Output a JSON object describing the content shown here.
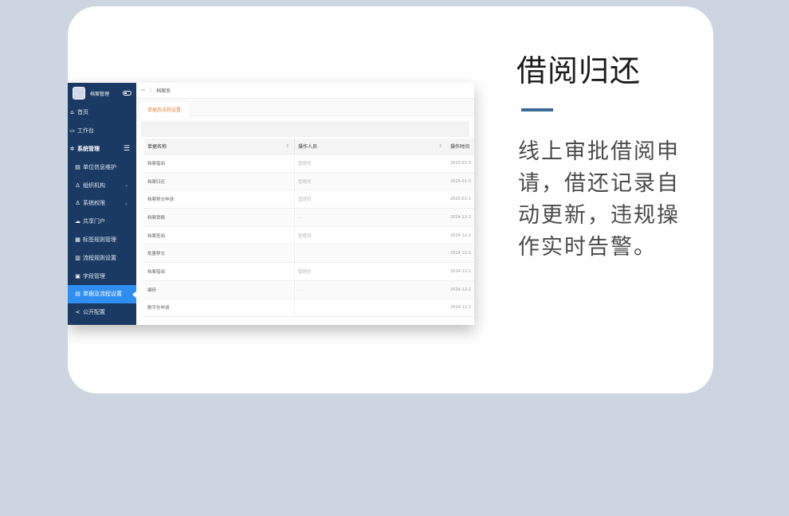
{
  "feature": {
    "title": "借阅归还",
    "description": "线上审批借阅申请，借还记录自动更新，违规操作实时告警。"
  },
  "colors": {
    "page_bg": "#ccd5e0",
    "sidebar_bg": "#1a3a63",
    "active_bg": "#2f8ef0",
    "accent": "#3d6a97"
  },
  "app": {
    "brand": "档案管理",
    "sidebar": {
      "items": [
        {
          "label": "首页",
          "icon": "home-icon"
        },
        {
          "label": "工作台",
          "icon": "desktop-icon"
        },
        {
          "label": "系统管理",
          "icon": "gear-icon"
        },
        {
          "label": "单位信息维护",
          "icon": "doc-icon"
        },
        {
          "label": "组织机构",
          "icon": "user-icon"
        },
        {
          "label": "系统权限",
          "icon": "users-icon"
        },
        {
          "label": "共享门户",
          "icon": "cloud-icon"
        },
        {
          "label": "标签规则管理",
          "icon": "grid-icon"
        },
        {
          "label": "流程规则设置",
          "icon": "table-icon"
        },
        {
          "label": "字段管理",
          "icon": "file-icon"
        },
        {
          "label": "单据及流程设置",
          "icon": "list-icon"
        },
        {
          "label": "公开配置",
          "icon": "share-icon"
        }
      ]
    },
    "topbar": {
      "back": "⇦",
      "breadcrumb": "档案系"
    },
    "tab": "单据及流程设置",
    "table": {
      "headers": [
        "单据名称",
        "操作人员",
        "操作时间"
      ],
      "rows": [
        [
          "档案借阅",
          "管理员",
          "2025-01-0"
        ],
        [
          "档案归还",
          "管理员",
          "2025-01-0"
        ],
        [
          "档案移交申请",
          "管理员",
          "2025-01-1"
        ],
        [
          "档案销毁",
          "…",
          "2024-12-2"
        ],
        [
          "档案查阅",
          "管理员",
          "2024-12-2"
        ],
        [
          "批量移交",
          "",
          "2024-12-2"
        ],
        [
          "档案借阅",
          "管理员",
          "2024-12-2"
        ],
        [
          "编研",
          "…",
          "2024-12-2"
        ],
        [
          "数字化申请",
          "",
          "2024-12-2"
        ]
      ]
    }
  }
}
